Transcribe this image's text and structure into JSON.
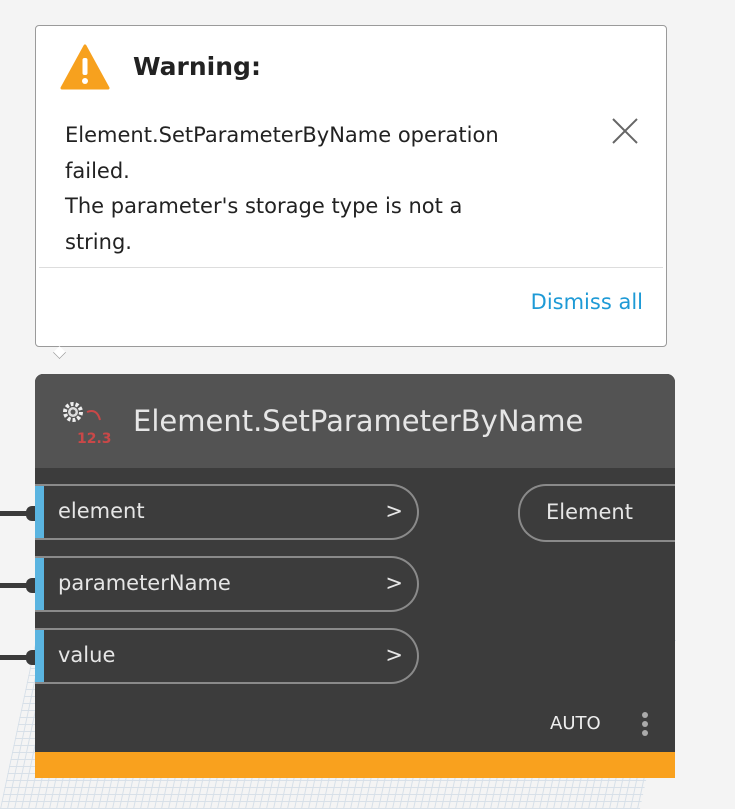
{
  "warning": {
    "title": "Warning:",
    "lines": [
      "Element.SetParameterByName operation",
      "failed.",
      "The parameter's storage type is not a",
      "string."
    ],
    "dismiss_label": "Dismiss all",
    "icon": "warning-triangle-icon",
    "close_icon": "close-icon"
  },
  "node": {
    "title": "Element.SetParameterByName",
    "icon": "gear-number-icon",
    "icon_text": "12.3",
    "inputs": [
      {
        "label": "element",
        "arrow": ">"
      },
      {
        "label": "parameterName",
        "arrow": ">"
      },
      {
        "label": "value",
        "arrow": ">"
      }
    ],
    "outputs": [
      {
        "label": "Element"
      }
    ],
    "lacing": "AUTO",
    "status_color": "#f9a11e",
    "port_color": "#5ab4e0"
  }
}
